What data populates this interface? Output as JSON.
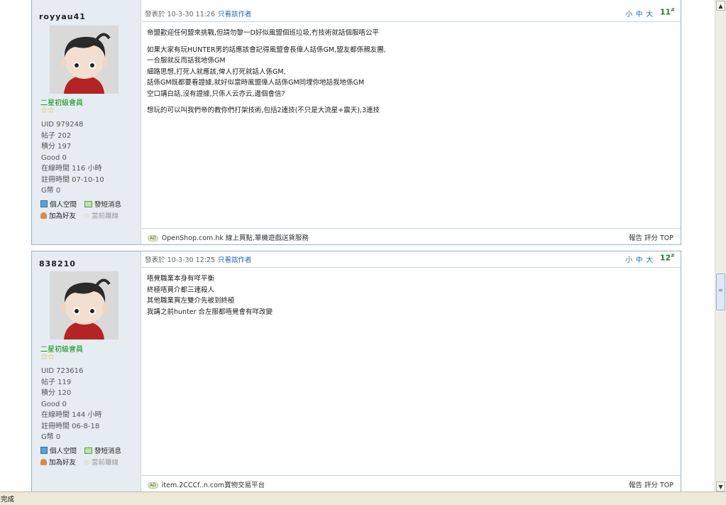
{
  "posts": [
    {
      "username": "royyau41",
      "rank": "二星初級會員",
      "stars": "☆☆",
      "stats": [
        "UID 979248",
        "帖子 202",
        "積分 197",
        "Good 0",
        "在線時間 116 小時",
        "註冊時間 07-10-10",
        "G幣 0"
      ],
      "links": {
        "space": "個人空間",
        "pm": "發短消息",
        "friend": "加為好友",
        "online": "當前離線"
      },
      "posted": "發表於 10-3-30 11:26",
      "author_only": "只看該作者",
      "sizes": "小 中 大",
      "floor": "11",
      "floor_sup": "#",
      "content": [
        "帝盟歡迎任何盟來挑戰,但請勿黎一D好似風盟個班垃圾,冇技術就話個服唔公平",
        "",
        "如果大家有玩HUNTER男的話應該會記得風盟會長偉人話係GM,盟友都係親友團,",
        "一合服就反而話我地係GM",
        "細路思想,打死人就應該,俾人打死就話人係GM,",
        "話係GM既都要看證據,就好似當時風盟偉人話係GM同埋你地話我地係GM",
        "空口講白話,沒有證據,只係人云亦云,邊個會信?",
        "",
        "想玩的可以叫我們帝的教你們打架技術,包括2連技(不只是大流星+震天),3連技"
      ],
      "ad_badge": "AD",
      "ad_text": "OpenShop.com.hk 線上買點,單機遊戲送貨服務",
      "actions": "報告 評分 TOP"
    },
    {
      "username": "838210",
      "rank": "二星初級會員",
      "stars": "☆☆",
      "stats": [
        "UID 723616",
        "帖子 119",
        "積分 120",
        "Good 0",
        "在線時間 144 小時",
        "註冊時間 06-8-18",
        "G幣 0"
      ],
      "links": {
        "space": "個人空間",
        "pm": "發短消息",
        "friend": "加為好友",
        "online": "當前離線"
      },
      "posted": "發表於 10-3-30 12:25",
      "author_only": "只看該作者",
      "sizes": "小 中 大",
      "floor": "12",
      "floor_sup": "#",
      "content": [
        "唔覺職業本身有咩平衡",
        "終極唔買介都三連殺人",
        "其他職業買左雙介先被到終極",
        "我講之前hunter 合左服都唔覺會有咩改變"
      ],
      "ad_badge": "AD",
      "ad_text": "item.2CCCf..n.com寶物交易平台",
      "actions": "報告 評分 TOP"
    }
  ],
  "statusbar": {
    "text": "完成"
  },
  "scrollbar": {
    "up": "▲",
    "down": "▼"
  }
}
